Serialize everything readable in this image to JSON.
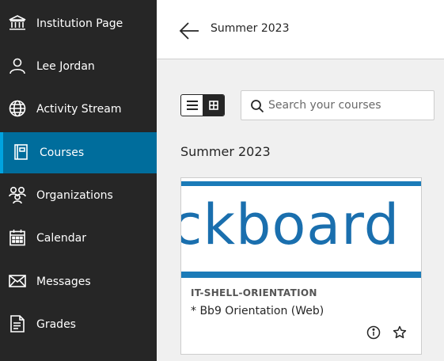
{
  "sidebar": {
    "items": [
      {
        "label": "Institution Page",
        "icon": "institution-icon",
        "active": false
      },
      {
        "label": "Lee Jordan",
        "icon": "user-icon",
        "active": false
      },
      {
        "label": "Activity Stream",
        "icon": "globe-icon",
        "active": false
      },
      {
        "label": "Courses",
        "icon": "courses-icon",
        "active": true
      },
      {
        "label": "Organizations",
        "icon": "organizations-icon",
        "active": false
      },
      {
        "label": "Calendar",
        "icon": "calendar-icon",
        "active": false
      },
      {
        "label": "Messages",
        "icon": "envelope-icon",
        "active": false
      },
      {
        "label": "Grades",
        "icon": "grades-icon",
        "active": false
      }
    ]
  },
  "header": {
    "breadcrumb": "Summer 2023",
    "back_icon": "arrow-left-icon"
  },
  "toolbar": {
    "view_modes": [
      {
        "icon": "list-view-icon",
        "selected": false
      },
      {
        "icon": "grid-view-icon",
        "selected": true
      }
    ],
    "search": {
      "placeholder": "Search your courses",
      "value": "",
      "icon": "search-icon"
    }
  },
  "section": {
    "title": "Summer 2023"
  },
  "course_card": {
    "banner_text": "ckboard O",
    "code": "IT-SHELL-ORIENTATION",
    "name": "* Bb9 Orientation (Web)",
    "actions": [
      "info-icon",
      "star-icon"
    ]
  },
  "colors": {
    "sidebar_bg": "#262626",
    "active_bg": "#006d9c",
    "accent": "#00a3e0",
    "banner_blue": "#1b7bb8",
    "page_bg": "#f0f0f0"
  }
}
